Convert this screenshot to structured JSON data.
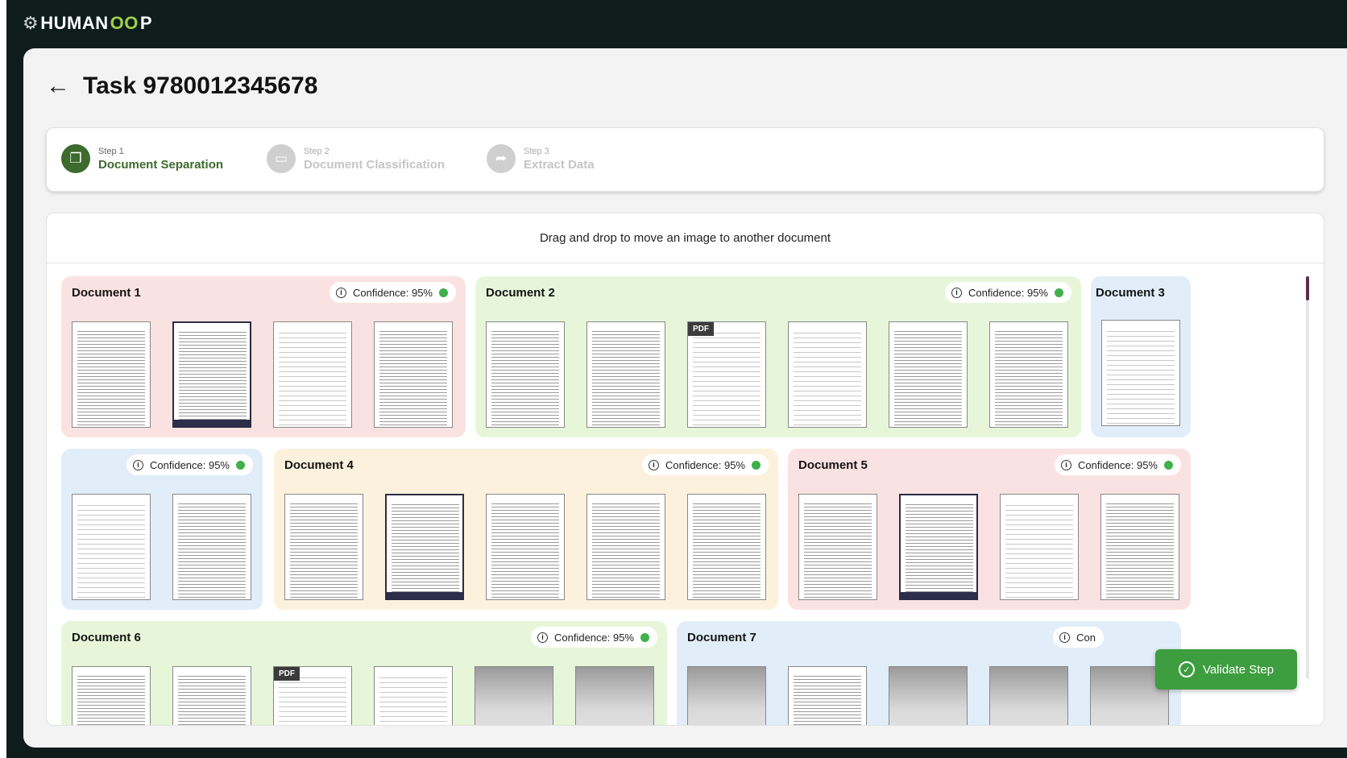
{
  "brand": {
    "logo_text_a": "HUMAN",
    "logo_text_b": "OO",
    "logo_text_c": "P",
    "gear_glyph": "⚙"
  },
  "task": {
    "title": "Task 9780012345678",
    "back_glyph": "←"
  },
  "steps": [
    {
      "num": "Step 1",
      "label": "Document Separation",
      "icon": "document-stack-icon",
      "glyph": "❐",
      "state": "active"
    },
    {
      "num": "Step 2",
      "label": "Document Classification",
      "icon": "folder-icon",
      "glyph": "▭",
      "state": "inactive"
    },
    {
      "num": "Step 3",
      "label": "Extract Data",
      "icon": "export-icon",
      "glyph": "➦",
      "state": "inactive"
    }
  ],
  "board": {
    "hint": "Drag and drop to move an image to another document"
  },
  "documents": {
    "doc1": {
      "title": "Document 1",
      "confidence": "Confidence: 95%"
    },
    "doc2": {
      "title": "Document 2",
      "confidence": "Confidence: 95%"
    },
    "doc3": {
      "title": "Document 3",
      "confidence": "Confidence: 95%"
    },
    "doc4": {
      "title": "Document 4",
      "confidence": "Confidence: 95%"
    },
    "doc5": {
      "title": "Document 5",
      "confidence": "Confidence: 95%"
    },
    "doc6": {
      "title": "Document 6",
      "confidence": "Confidence: 95%"
    },
    "doc7": {
      "title": "Document 7",
      "confidence": "Con"
    }
  },
  "pdf_label": "PDF",
  "info_glyph": "i",
  "validate": {
    "label": "Validate Step",
    "icon": "check-badge-icon",
    "glyph": "✓"
  },
  "colors": {
    "accent_green": "#3d6a2d",
    "button_green": "#3d9d3f",
    "confidence_dot": "#3fb04a",
    "topbar": "#0f1c1c"
  }
}
